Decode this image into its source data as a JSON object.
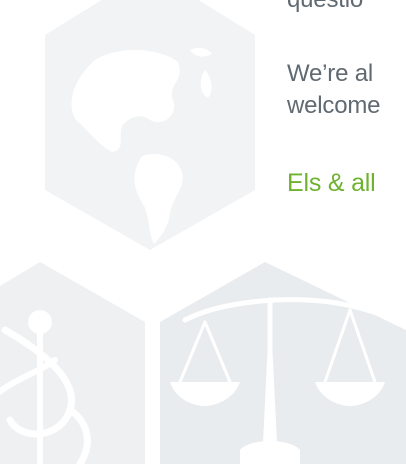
{
  "text": {
    "cut_line": "questio",
    "body_line_1": "We’re al",
    "body_line_2": "welcome",
    "signoff": "Els & all"
  },
  "decoration": {
    "icons": [
      "globe-icon",
      "caduceus-icon",
      "scales-of-justice-icon"
    ]
  },
  "colors": {
    "body_text": "#606a72",
    "signoff_text": "#6fb230",
    "hexagon_fill": "#f1f3f4",
    "hexagon_dark": "#e8ebed",
    "icon_fill": "#ffffff"
  }
}
